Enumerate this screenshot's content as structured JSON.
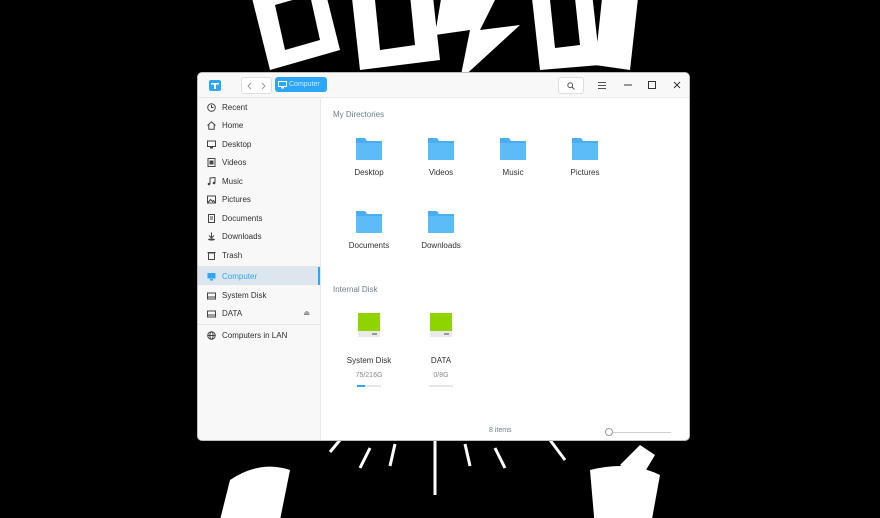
{
  "titlebar": {
    "breadcrumb_label": "Computer",
    "icons": [
      "file-manager-app-icon",
      "back-arrow-icon",
      "forward-arrow-icon",
      "computer-icon",
      "search-icon",
      "menu-icon",
      "minimize-icon",
      "maximize-icon",
      "close-icon"
    ]
  },
  "sidebar": {
    "items": [
      {
        "label": "Recent",
        "icon": "clock-icon"
      },
      {
        "label": "Home",
        "icon": "home-icon"
      },
      {
        "label": "Desktop",
        "icon": "desktop-icon"
      },
      {
        "label": "Videos",
        "icon": "film-icon"
      },
      {
        "label": "Music",
        "icon": "music-note-icon"
      },
      {
        "label": "Pictures",
        "icon": "picture-icon"
      },
      {
        "label": "Documents",
        "icon": "document-icon"
      },
      {
        "label": "Downloads",
        "icon": "download-icon"
      },
      {
        "label": "Trash",
        "icon": "trash-icon"
      }
    ],
    "devices": [
      {
        "label": "Computer",
        "icon": "monitor-icon",
        "active": true
      },
      {
        "label": "System Disk",
        "icon": "disk-icon"
      },
      {
        "label": "DATA",
        "icon": "disk-icon",
        "eject": "⏏"
      }
    ],
    "network": [
      {
        "label": "Computers in LAN",
        "icon": "network-icon"
      }
    ]
  },
  "main": {
    "my_directories_title": "My Directories",
    "directories": [
      "Desktop",
      "Videos",
      "Music",
      "Pictures",
      "Documents",
      "Downloads"
    ],
    "internal_disk_title": "Internal Disk",
    "disks": [
      {
        "label": "System Disk",
        "usage": "75/216G",
        "fill": 0.35
      },
      {
        "label": "DATA",
        "usage": "0/8G",
        "fill": 0.0
      }
    ]
  },
  "status": {
    "item_count": "8 items",
    "zoom_level": 0.0
  },
  "colors": {
    "accent": "#2ca7f8",
    "folder": "#5cbcf7",
    "disk": "#8fd400",
    "background": "#000000"
  }
}
